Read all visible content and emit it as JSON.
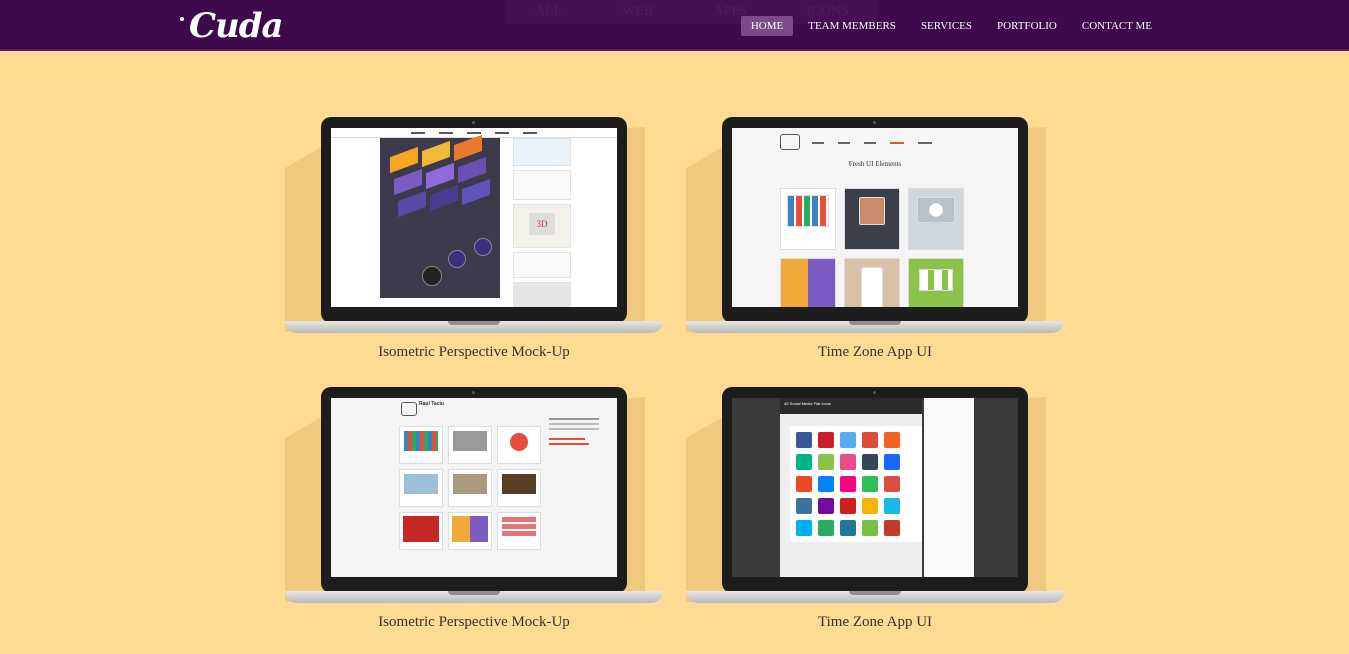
{
  "brand": {
    "logo_text": "Cuda"
  },
  "ghost_filters": [
    "ALL",
    "WEB",
    "APPS",
    "ICONS"
  ],
  "nav": {
    "items": [
      {
        "label": "HOME",
        "active": true
      },
      {
        "label": "TEAM MEMBERS",
        "active": false
      },
      {
        "label": "SERVICES",
        "active": false
      },
      {
        "label": "PORTFOLIO",
        "active": false
      },
      {
        "label": "CONTACT ME",
        "active": false
      }
    ]
  },
  "portfolio": {
    "items": [
      {
        "caption": "Isometric Perspective Mock-Up",
        "screen": "isometric"
      },
      {
        "caption": "Time Zone App UI",
        "screen": "fresh-ui"
      },
      {
        "caption": "Isometric Perspective Mock-Up",
        "screen": "raul-profile"
      },
      {
        "caption": "Time Zone App UI",
        "screen": "social-icons"
      }
    ]
  },
  "screen_text": {
    "fresh_ui_title": "Fresh UI Elements",
    "raul_name": "Raul Taciu",
    "social_title": "40 Social Media Flat Icons"
  },
  "colors": {
    "background": "#fedb92",
    "navbar": "#3e0a4b",
    "nav_active": "#7b4a87",
    "caption_text": "#333333"
  }
}
